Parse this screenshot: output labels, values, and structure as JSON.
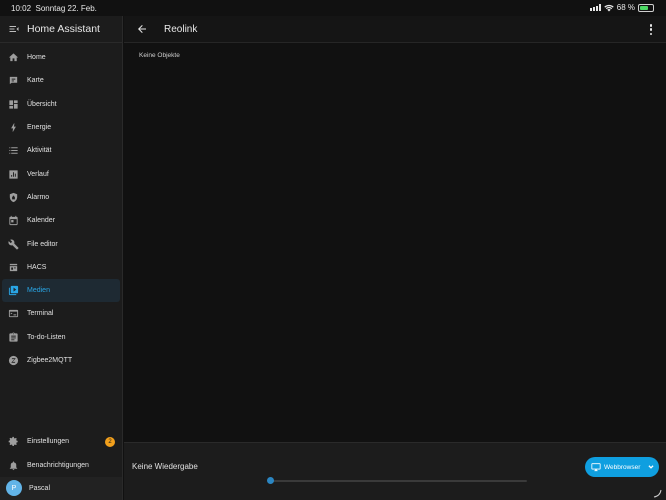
{
  "status": {
    "time": "10:02",
    "date": "Sonntag 22. Feb.",
    "battery": "68 %",
    "battery_level": 0.68
  },
  "sidebar": {
    "title": "Home Assistant",
    "items": [
      {
        "label": "Home",
        "icon": "home-icon"
      },
      {
        "label": "Karte",
        "icon": "map-icon"
      },
      {
        "label": "Übersicht",
        "icon": "dashboard-icon"
      },
      {
        "label": "Energie",
        "icon": "lightning-icon"
      },
      {
        "label": "Aktivität",
        "icon": "list-icon"
      },
      {
        "label": "Verlauf",
        "icon": "chart-icon"
      },
      {
        "label": "Alarmo",
        "icon": "shield-icon"
      },
      {
        "label": "Kalender",
        "icon": "calendar-icon"
      },
      {
        "label": "File editor",
        "icon": "wrench-icon"
      },
      {
        "label": "HACS",
        "icon": "store-icon"
      },
      {
        "label": "Medien",
        "icon": "media-icon",
        "active": true
      },
      {
        "label": "Terminal",
        "icon": "terminal-icon"
      },
      {
        "label": "To-do-Listen",
        "icon": "clipboard-icon"
      },
      {
        "label": "Zigbee2MQTT",
        "icon": "zigbee-icon"
      }
    ],
    "bottom": {
      "settings_label": "Einstellungen",
      "settings_badge": "2",
      "notifications_label": "Benachrichtigungen",
      "user_name": "Pascal",
      "user_initial": "P"
    }
  },
  "header": {
    "title": "Reolink"
  },
  "main": {
    "empty_text": "Keine Objekte"
  },
  "player": {
    "status_text": "Keine Wiedergabe",
    "target_label": "Webbrowser",
    "progress": 0
  },
  "colors": {
    "accent": "#29a6e6",
    "badge": "#f2a01c",
    "button": "#0f9fe0"
  }
}
